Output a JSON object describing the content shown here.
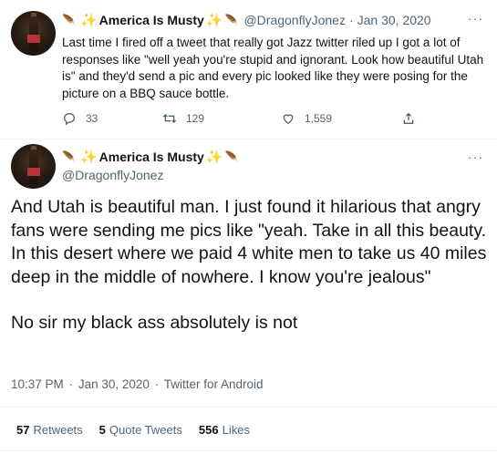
{
  "tweet1": {
    "display_name": "America Is Musty",
    "handle": "@DragonflyJonez",
    "separator": "·",
    "date": "Jan 30, 2020",
    "more": "···",
    "text": "Last time I fired off a tweet that really got Jazz twitter riled up I got a lot of responses like \"well yeah you're stupid and ignorant. Look how beautiful Utah is\" and they'd send a pic and every pic looked like they were posing for the picture on a BBQ sauce bottle.",
    "reply_count": "33",
    "retweet_count": "129",
    "like_count": "1,559",
    "icons": [
      "feather-icon",
      "sparkle-icon",
      "reply-icon",
      "retweet-icon",
      "like-icon",
      "share-icon"
    ]
  },
  "tweet2": {
    "display_name": "America Is Musty",
    "handle": "@DragonflyJonez",
    "more": "···",
    "text": "And Utah is beautiful man. I just found it hilarious that angry fans were sending me pics like \"yeah. Take in all this beauty. In this desert where we paid 4 white men to take us 40 miles deep in the middle of nowhere. I know you're jealous\"",
    "text2": "No sir my black ass absolutely is not",
    "time": "10:37 PM",
    "date": "Jan 30, 2020",
    "source": "Twitter for Android",
    "sep": "·",
    "retweets_count": "57",
    "retweets_label": "Retweets",
    "quotes_count": "5",
    "quotes_label": "Quote Tweets",
    "likes_count": "556",
    "likes_label": "Likes"
  },
  "colors": {
    "text": "#0f1419",
    "muted": "#536471",
    "sparkle": "#f5b800",
    "divider": "#eff3f4"
  }
}
